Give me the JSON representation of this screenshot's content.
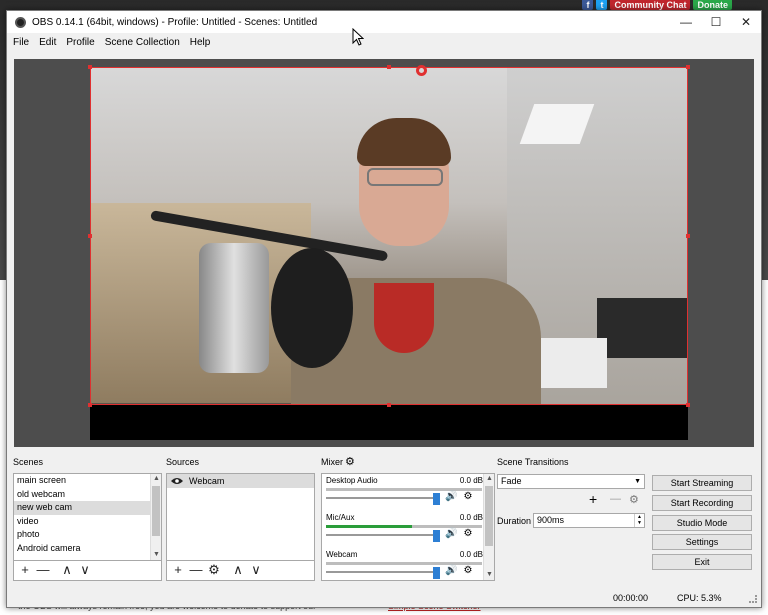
{
  "background_page": {
    "badges": [
      {
        "label": "f",
        "color": "#3b5998"
      },
      {
        "label": "t",
        "color": "#1da1f2"
      },
      {
        "label": "Community Chat",
        "color": "#c0262d"
      },
      {
        "label": "Donate",
        "color": "#2aa84a"
      }
    ],
    "bottom_text_left": "the OBS will always remain free, you are welcome to donate to support our",
    "bottom_text_right": "Simple Scene Switcher"
  },
  "window": {
    "title": "OBS 0.14.1 (64bit, windows) - Profile: Untitled - Scenes: Untitled",
    "controls": {
      "minimize": "—",
      "maximize": "☐",
      "close": "✕"
    }
  },
  "menu": [
    "File",
    "Edit",
    "Profile",
    "Scene Collection",
    "Help"
  ],
  "scenes": {
    "label": "Scenes",
    "items": [
      "main screen",
      "old webcam",
      "new web cam",
      "video",
      "photo",
      "Android camera"
    ],
    "selected_index": 2,
    "toolbar": {
      "add": "+",
      "remove": "—",
      "up": "∧",
      "down": "∨"
    }
  },
  "sources": {
    "label": "Sources",
    "items": [
      {
        "name": "Webcam",
        "visible": true
      }
    ],
    "toolbar": {
      "add": "+",
      "remove": "—",
      "settings": "⚙",
      "up": "∧",
      "down": "∨"
    }
  },
  "mixer": {
    "label": "Mixer",
    "tracks": [
      {
        "name": "Desktop Audio",
        "db": "0.0 dB",
        "level": 0
      },
      {
        "name": "Mic/Aux",
        "db": "0.0 dB",
        "level": 0.55
      },
      {
        "name": "Webcam",
        "db": "0.0 dB",
        "level": 0
      }
    ]
  },
  "transitions": {
    "label": "Scene Transitions",
    "selected": "Fade",
    "duration_label": "Duration",
    "duration_value": "900ms",
    "add": "+",
    "remove": "—"
  },
  "controls": {
    "start_streaming": "Start Streaming",
    "start_recording": "Start Recording",
    "studio_mode": "Studio Mode",
    "settings": "Settings",
    "exit": "Exit"
  },
  "status": {
    "time": "00:00:00",
    "cpu": "CPU: 5.3%"
  },
  "colors": {
    "selection_red": "#e03030",
    "volume_blue": "#2d7fd4",
    "meter_green": "#2a9d3a"
  }
}
